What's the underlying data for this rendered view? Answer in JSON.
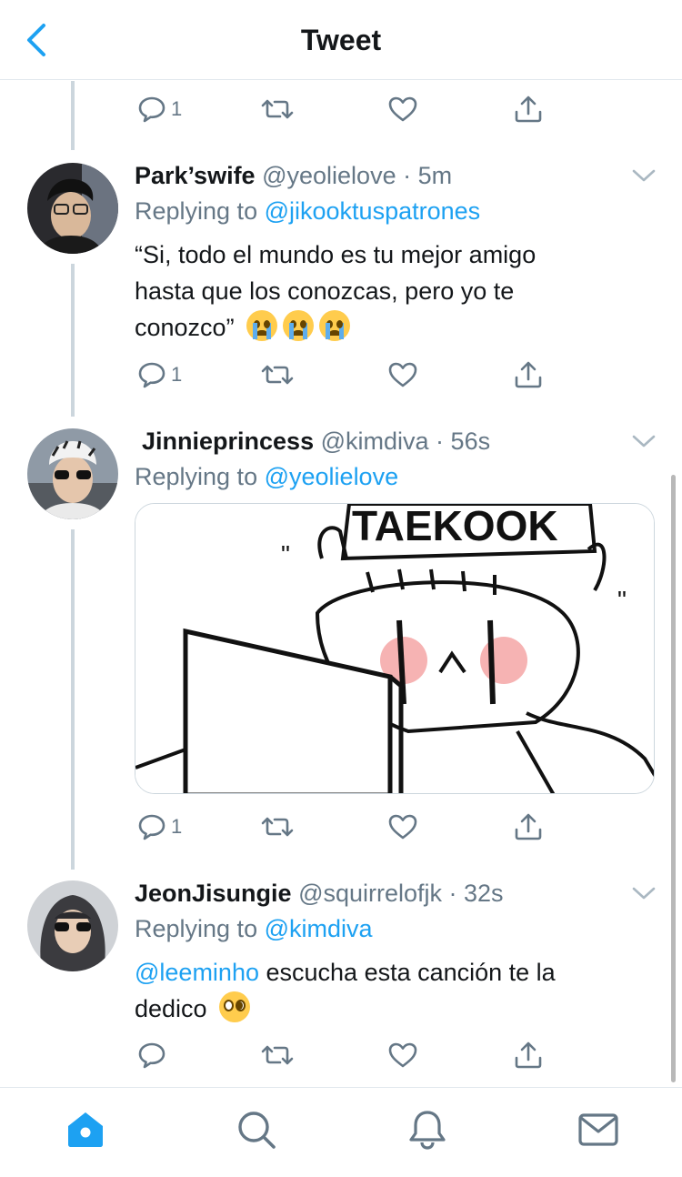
{
  "header": {
    "title": "Tweet",
    "back_icon": "chevron-left-icon",
    "accent": "#1da1f2"
  },
  "top_actions": {
    "reply_count": "1"
  },
  "tweets": [
    {
      "name": "Park’swife",
      "handle": "@yeolielove",
      "time": "5m",
      "replying_prefix": "Replying to",
      "replying_to": "@jikooktuspatrones",
      "text_line1": "“Si, todo el mundo es tu mejor amigo",
      "text_line2": "hasta que los conozcas, pero yo te",
      "text_line3": "conozco”",
      "reply_count": "1"
    },
    {
      "name": "Jinnieprincess",
      "handle": "@kimdiva",
      "time": "56s",
      "replying_prefix": "Replying to",
      "replying_to": "@yeolielove",
      "image_caption": "TAEKOOK",
      "reply_count": "1"
    },
    {
      "name": "JeonJisungie",
      "handle": "@squirrelofjk",
      "time": "32s",
      "replying_prefix": "Replying to",
      "replying_to": "@kimdiva",
      "mention": "@leeminho",
      "text_rest": "escucha esta canción te la",
      "text_line2": "dedico",
      "reply_count": ""
    }
  ],
  "tabs": [
    {
      "icon": "home-icon",
      "active": true
    },
    {
      "icon": "search-icon",
      "active": false
    },
    {
      "icon": "notifications-icon",
      "active": false
    },
    {
      "icon": "messages-icon",
      "active": false
    }
  ],
  "colors": {
    "text": "#14171a",
    "secondary": "#657786",
    "divider": "#e1e8ed",
    "thread_line": "#ccd6dd"
  }
}
